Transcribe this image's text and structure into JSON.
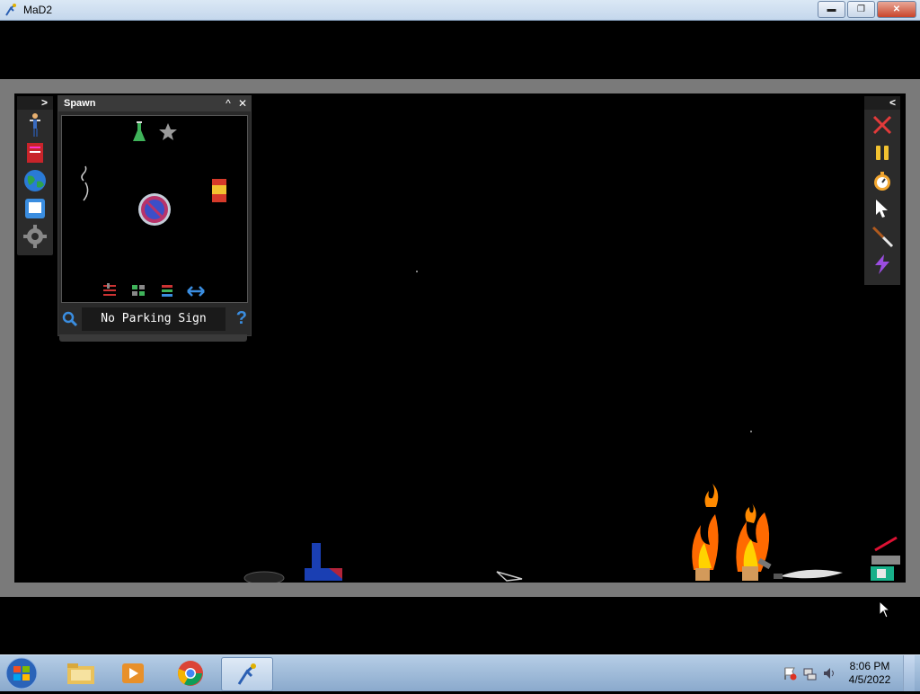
{
  "window": {
    "title": "MaD2",
    "minimize_label": "▬",
    "restore_label": "❐",
    "close_label": "✕"
  },
  "spawn_panel": {
    "title": "Spawn",
    "collapse_label": "^",
    "close_label": "✕",
    "selected_item_name": "No Parking Sign",
    "help_label": "?"
  },
  "left_toolbar": {
    "toggle_label": ">",
    "items": [
      "humanoid-icon",
      "book-icon",
      "globe-icon",
      "save-icon",
      "gear-icon"
    ]
  },
  "right_toolbar": {
    "toggle_label": "<",
    "items": [
      "close-x-icon",
      "pause-icon",
      "stopwatch-icon",
      "pointer-icon",
      "knife-icon",
      "lightning-icon"
    ]
  },
  "taskbar": {
    "items": [
      "windows-start-icon",
      "file-explorer-icon",
      "media-player-icon",
      "chrome-icon",
      "mad2-icon"
    ],
    "clock_time": "8:06 PM",
    "clock_date": "4/5/2022"
  },
  "colors": {
    "panel_bg": "#2a2a2a",
    "viewport_bg": "#000000",
    "frame_gray": "#7a7a7a",
    "taskbar_blue": "#a9c3e0"
  }
}
